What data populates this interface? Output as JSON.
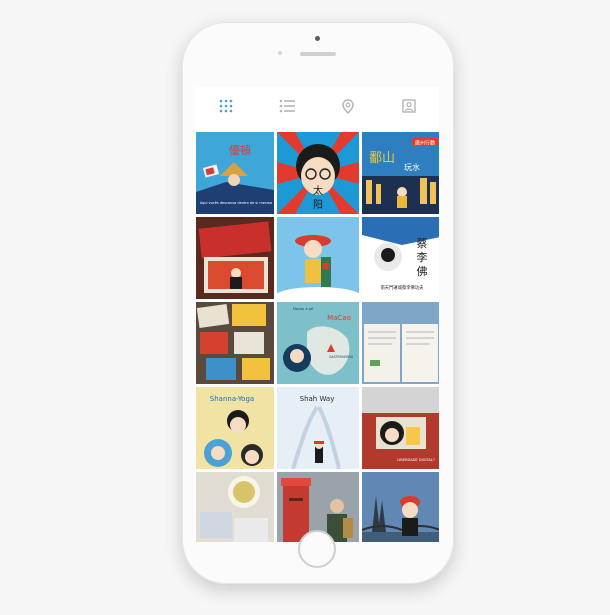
{
  "device": {
    "background_color": "#f6f6f6",
    "frame_color": "#fbfbfb"
  },
  "tabs": [
    {
      "id": "grid-view",
      "icon": "grid-icon",
      "active": true,
      "color": "#4a9fd8"
    },
    {
      "id": "list-view",
      "icon": "list-icon",
      "active": false,
      "color": "#b5b5b5"
    },
    {
      "id": "map-view",
      "icon": "location-pin-icon",
      "active": false,
      "color": "#b5b5b5"
    },
    {
      "id": "tagged-view",
      "icon": "person-tag-icon",
      "active": false,
      "color": "#b5b5b5"
    }
  ],
  "posts": {
    "p1": {
      "title": "優頓",
      "caption": "Aqui vocês descansa dentro de si mesmo"
    },
    "p2": {
      "title": "太",
      "subtitle": "阳"
    },
    "p3": {
      "title": "鄱山",
      "subtitle": "玩水",
      "banner": "廣州行動"
    },
    "p4": {},
    "p5": {},
    "p6": {
      "title": "蔡",
      "title2": "李",
      "title3": "佛",
      "caption": "南天門運城蔡李佛功夫"
    },
    "p7": {},
    "p8": {
      "title": "MaCao",
      "subtitle": "Macau a pé",
      "caption": "GASTRONOMIA"
    },
    "p9": {},
    "p10": {
      "title": "Shanna-Yoga"
    },
    "p11": {
      "title": "Shah Way"
    },
    "p12": {
      "caption": "LIBERDADE DIGITAL?"
    },
    "p13": {},
    "p14": {},
    "p15": {}
  }
}
